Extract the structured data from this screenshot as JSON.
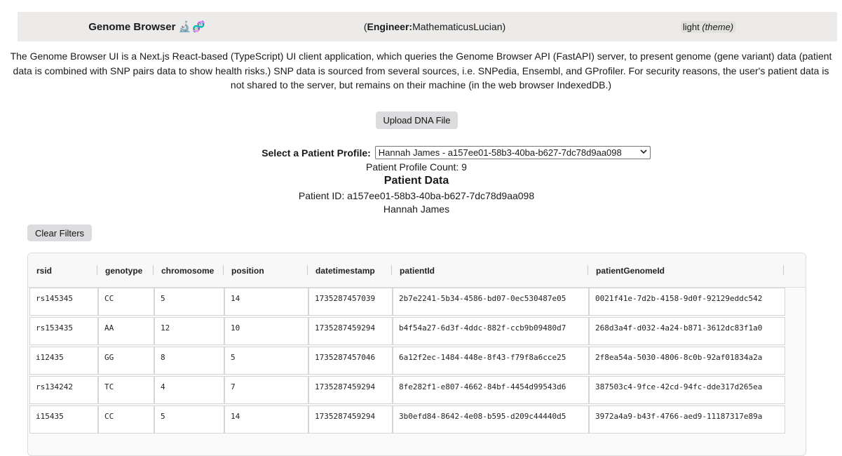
{
  "header": {
    "title": "Genome Browser",
    "title_icons": "🔬🧬",
    "engineer_open": "(",
    "engineer_label": "Engineer:",
    "engineer_name": "MathematicusLucian",
    "engineer_close": ")",
    "theme_value": "light",
    "theme_label": "(theme)"
  },
  "description": "The Genome Browser UI is a Next.js React-based (TypeScript) UI client application, which queries the Genome Browser API (FastAPI) server, to present genome (gene variant) data (patient data is combined with SNP pairs data to show health risks.) SNP data is sourced from several sources, i.e. SNPedia, Ensembl, and GProfiler. For security reasons, the user's patient data is not shared to the server, but remains on their machine (in the web browser IndexedDB.)",
  "upload_button": "Upload DNA File",
  "profile": {
    "label": "Select a Patient Profile:",
    "selected": "Hannah James - a157ee01-58b3-40ba-b627-7dc78d9aa098",
    "count_text": "Patient Profile Count: 9"
  },
  "patient": {
    "heading": "Patient Data",
    "id_text": "Patient ID: a157ee01-58b3-40ba-b627-7dc78d9aa098",
    "name": "Hannah James"
  },
  "clear_filters": "Clear Filters",
  "table": {
    "columns": [
      "rsid",
      "genotype",
      "chromosome",
      "position",
      "datetimestamp",
      "patientId",
      "patientGenomeId"
    ],
    "rows": [
      [
        "rs145345",
        "CC",
        "5",
        "14",
        "1735287457039",
        "2b7e2241-5b34-4586-bd07-0ec530487e05",
        "0021f41e-7d2b-4158-9d0f-92129eddc542"
      ],
      [
        "rs153435",
        "AA",
        "12",
        "10",
        "1735287459294",
        "b4f54a27-6d3f-4ddc-882f-ccb9b09480d7",
        "268d3a4f-d032-4a24-b871-3612dc83f1a0"
      ],
      [
        "i12435",
        "GG",
        "8",
        "5",
        "1735287457046",
        "6a12f2ec-1484-448e-8f43-f79f8a6cce25",
        "2f8ea54a-5030-4806-8c0b-92af01834a2a"
      ],
      [
        "rs134242",
        "TC",
        "4",
        "7",
        "1735287459294",
        "8fe282f1-e807-4662-84bf-4454d99543d6",
        "387503c4-9fce-42cd-94fc-dde317d265ea"
      ],
      [
        "i15435",
        "CC",
        "5",
        "14",
        "1735287459294",
        "3b0efd84-8642-4e08-b595-d209c44440d5",
        "3972a4a9-b43f-4766-aed9-11187317e89a"
      ]
    ]
  }
}
